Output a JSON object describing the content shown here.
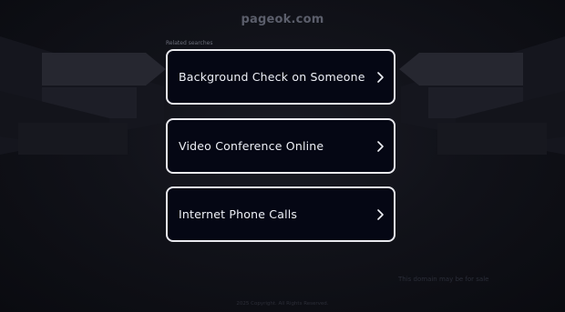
{
  "header": {
    "domain": "pageok.com"
  },
  "recent_searches": {
    "label": "Related searches",
    "items": [
      {
        "label": "Background Check on Someone",
        "icon": "chevron-right-icon"
      },
      {
        "label": "Video Conference Online",
        "icon": "chevron-right-icon"
      },
      {
        "label": "Internet Phone Calls",
        "icon": "chevron-right-icon"
      }
    ]
  },
  "footer": {
    "sale_text": "This domain may be for sale",
    "copyright": "2025 Copyright. All Rights Reserved."
  },
  "colors": {
    "background": "#0b0c13",
    "card_background": "#050714",
    "card_border": "#e9e9ee",
    "card_text": "#eef0f6",
    "muted_text": "#5b5e6b"
  }
}
